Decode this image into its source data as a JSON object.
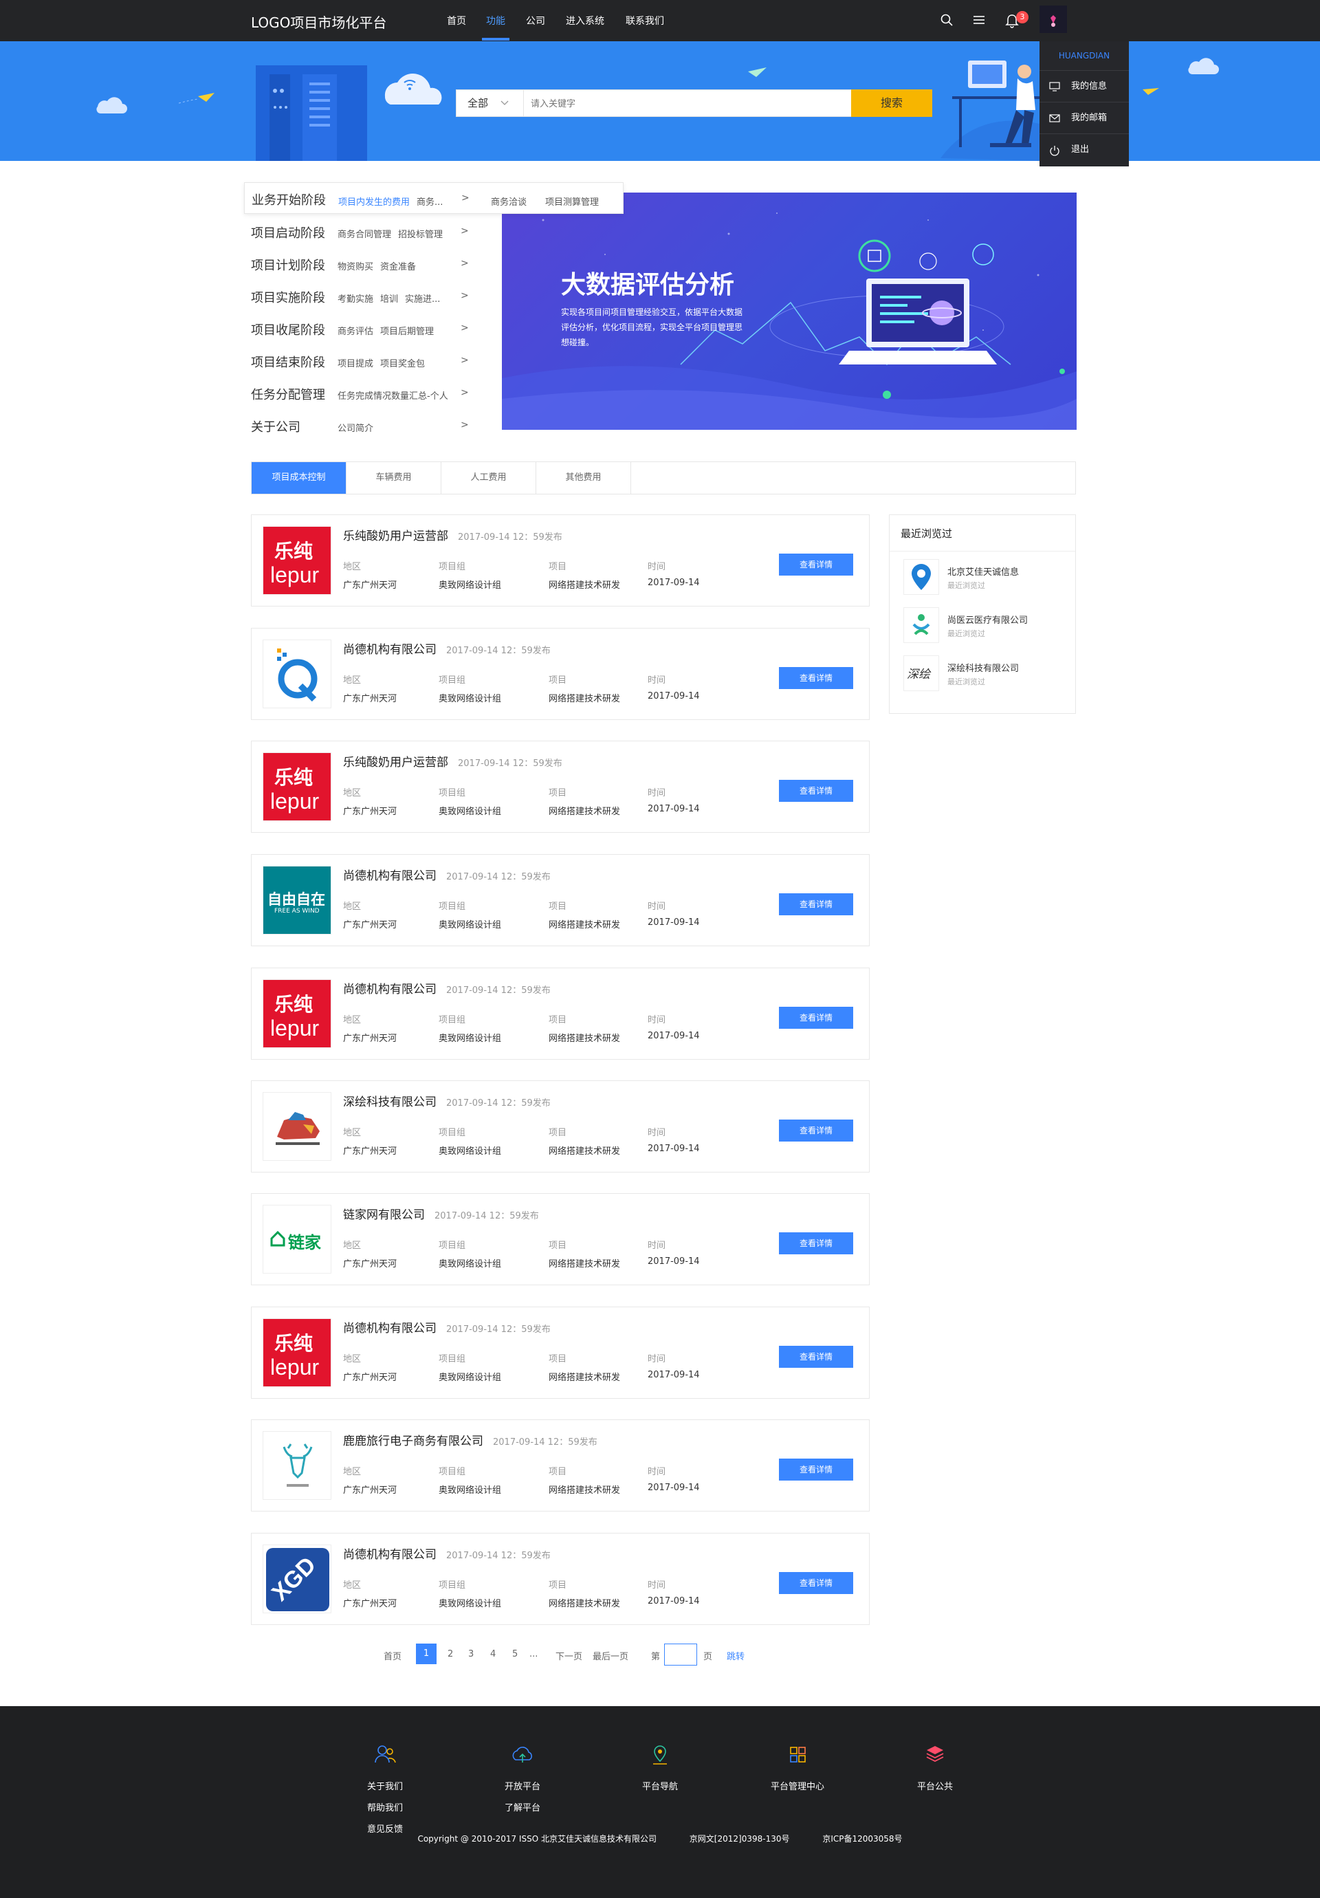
{
  "header": {
    "logo": "LOGO项目市场化平台",
    "nav": [
      "首页",
      "功能",
      "公司",
      "进入系统",
      "联系我们"
    ],
    "active_nav": "功能",
    "notification_count": "3",
    "user": "HUANGDIAN",
    "user_menu": [
      "我的信息",
      "我的邮箱",
      "退出"
    ]
  },
  "search": {
    "category": "全部",
    "placeholder": "请入关键字",
    "button": "搜索"
  },
  "categories": [
    {
      "title": "业务开始阶段",
      "links": [
        "项目内发生的费用",
        "商务...",
        "商务洽谈",
        "项目测算管理"
      ]
    },
    {
      "title": "项目启动阶段",
      "links": [
        "商务合同管理",
        "招投标管理"
      ]
    },
    {
      "title": "项目计划阶段",
      "links": [
        "物资购买",
        "资金准备"
      ]
    },
    {
      "title": "项目实施阶段",
      "links": [
        "考勤实施",
        "培训",
        "实施进..."
      ]
    },
    {
      "title": "项目收尾阶段",
      "links": [
        "商务评估",
        "项目后期管理"
      ]
    },
    {
      "title": "项目结束阶段",
      "links": [
        "项目提成",
        "项目奖金包"
      ]
    },
    {
      "title": "任务分配管理",
      "links": [
        "任务完成情况数量汇总-个人"
      ]
    },
    {
      "title": "关于公司",
      "links": [
        "公司简介"
      ]
    }
  ],
  "hero": {
    "title": "大数据评估分析",
    "text": "实现各项目间项目管理经验交互，依据平台大数据评估分析，优化项目流程，实现全平台项目管理思想碰撞。"
  },
  "tabs": [
    "项目成本控制",
    "车辆费用",
    "人工费用",
    "其他费用"
  ],
  "labels": {
    "region": "地区",
    "group": "项目组",
    "project": "项目",
    "time": "时间",
    "detail": "查看详情"
  },
  "cards": [
    {
      "name": "乐纯酸奶用户运营部",
      "date": "2017-09-14  12：59发布",
      "region": "广东广州天河",
      "group": "奥致网络设计组",
      "project": "网络搭建技术研发",
      "time": "2017-09-14",
      "logo": "lepur"
    },
    {
      "name": "尚德机构有限公司",
      "date": "2017-09-14  12：59发布",
      "region": "广东广州天河",
      "group": "奥致网络设计组",
      "project": "网络搭建技术研发",
      "time": "2017-09-14",
      "logo": "q"
    },
    {
      "name": "乐纯酸奶用户运营部",
      "date": "2017-09-14  12：59发布",
      "region": "广东广州天河",
      "group": "奥致网络设计组",
      "project": "网络搭建技术研发",
      "time": "2017-09-14",
      "logo": "lepur"
    },
    {
      "name": "尚德机构有限公司",
      "date": "2017-09-14  12：59发布",
      "region": "广东广州天河",
      "group": "奥致网络设计组",
      "project": "网络搭建技术研发",
      "time": "2017-09-14",
      "logo": "free"
    },
    {
      "name": "尚德机构有限公司",
      "date": "2017-09-14  12：59发布",
      "region": "广东广州天河",
      "group": "奥致网络设计组",
      "project": "网络搭建技术研发",
      "time": "2017-09-14",
      "logo": "lepur"
    },
    {
      "name": "深绘科技有限公司",
      "date": "2017-09-14  12：59发布",
      "region": "广东广州天河",
      "group": "奥致网络设计组",
      "project": "网络搭建技术研发",
      "time": "2017-09-14",
      "logo": "pic"
    },
    {
      "name": "链家网有限公司",
      "date": "2017-09-14  12：59发布",
      "region": "广东广州天河",
      "group": "奥致网络设计组",
      "project": "网络搭建技术研发",
      "time": "2017-09-14",
      "logo": "lianjia"
    },
    {
      "name": "尚德机构有限公司",
      "date": "2017-09-14  12：59发布",
      "region": "广东广州天河",
      "group": "奥致网络设计组",
      "project": "网络搭建技术研发",
      "time": "2017-09-14",
      "logo": "lepur"
    },
    {
      "name": "鹿鹿旅行电子商务有限公司",
      "date": "2017-09-14  12：59发布",
      "region": "广东广州天河",
      "group": "奥致网络设计组",
      "project": "网络搭建技术研发",
      "time": "2017-09-14",
      "logo": "deer"
    },
    {
      "name": "尚德机构有限公司",
      "date": "2017-09-14  12：59发布",
      "region": "广东广州天河",
      "group": "奥致网络设计组",
      "project": "网络搭建技术研发",
      "time": "2017-09-14",
      "logo": "xgd"
    }
  ],
  "logo_text": {
    "lepur_1": "乐纯",
    "lepur_2": "lepur",
    "free_1": "自由自在",
    "free_2": "FREE AS WIND",
    "lianjia": "链家",
    "xgd": "XGD"
  },
  "recent": {
    "title": "最近浏览过",
    "items": [
      {
        "name": "北京艾佳天诚信息",
        "sub": "最近浏览过"
      },
      {
        "name": "尚医云医疗有限公司",
        "sub": "最近浏览过"
      },
      {
        "name": "深绘科技有限公司",
        "sub": "最近浏览过"
      }
    ],
    "shenhui_logo": "深绘"
  },
  "pager": {
    "first": "首页",
    "pages": [
      "1",
      "2",
      "3",
      "4",
      "5",
      "..."
    ],
    "next": "下一页",
    "last": "最后一页",
    "di": "第",
    "ye": "页",
    "jump": "跳转"
  },
  "footer": {
    "cols": [
      {
        "links": [
          "关于我们",
          "帮助我们",
          "意见反馈"
        ]
      },
      {
        "links": [
          "开放平台",
          "了解平台"
        ]
      },
      {
        "links": [
          "平台导航"
        ]
      },
      {
        "links": [
          "平台管理中心"
        ]
      },
      {
        "links": [
          "平台公共"
        ]
      }
    ],
    "copyright": "Copyright @ 2010-2017 ISSO 北京艾佳天诚信息技术有限公司",
    "license1": "京网文[2012]0398-130号",
    "license2": "京ICP备12003058号"
  },
  "colors": {
    "accent": "#3a86ff",
    "banner": "#2f86f0",
    "dark": "#242527",
    "search_btn": "#f7b500",
    "brand_red": "#e2142d"
  }
}
